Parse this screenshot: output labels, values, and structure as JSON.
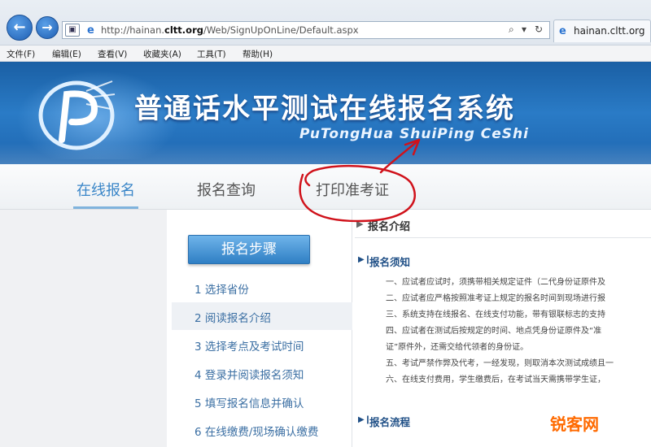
{
  "browser": {
    "url_prefix": "http://hainan.",
    "url_domain": "cltt.org",
    "url_path": "/Web/SignUpOnLine/Default.aspx",
    "tab_title": "hainan.cltt.org",
    "menu": [
      "文件(F)",
      "编辑(E)",
      "查看(V)",
      "收藏夹(A)",
      "工具(T)",
      "帮助(H)"
    ],
    "icons": [
      "back-icon",
      "forward-icon",
      "search-icon",
      "refresh-icon"
    ]
  },
  "banner": {
    "title": "普通话水平测试在线报名系统",
    "subtitle": "PuTongHua ShuiPing CeShi"
  },
  "sitenav": {
    "items": [
      "在线报名",
      "报名查询",
      "打印准考证"
    ],
    "active_index": 0
  },
  "sidebar": {
    "steps_button": "报名步骤",
    "steps": [
      "1 选择省份",
      "2 阅读报名介绍",
      "3 选择考点及考试时间",
      "4 登录并阅读报名须知",
      "5 填写报名信息并确认",
      "6 在线缴费/现场确认缴费"
    ],
    "highlighted_index": 1
  },
  "content": {
    "heading": "报名介绍",
    "sections": [
      {
        "title": "报名须知",
        "lines": [
          "一、应试者应试时，须携带相关规定证件（二代身份证原件及",
          "二、应试者应严格按照准考证上规定的报名时间到现场进行报",
          "三、系统支持在线报名、在线支付功能，带有银联标志的支持",
          "四、应试者在测试后按规定的时间、地点凭身份证原件及“准",
          "证”原件外，还需交给代领者的身份证。",
          "五、考试严禁作弊及代考，一经发现，则取消本次测试成绩且一",
          "六、在线支付费用，学生缴费后，在考试当天需携带学生证，"
        ]
      },
      {
        "title": "报名流程",
        "lines": []
      }
    ]
  },
  "watermark": "锐客网",
  "colors": {
    "banner_blue": "#2a7bc6",
    "active_nav": "#3a86c8",
    "annotation_red": "#d0121b",
    "watermark_orange": "#ff6a00"
  }
}
